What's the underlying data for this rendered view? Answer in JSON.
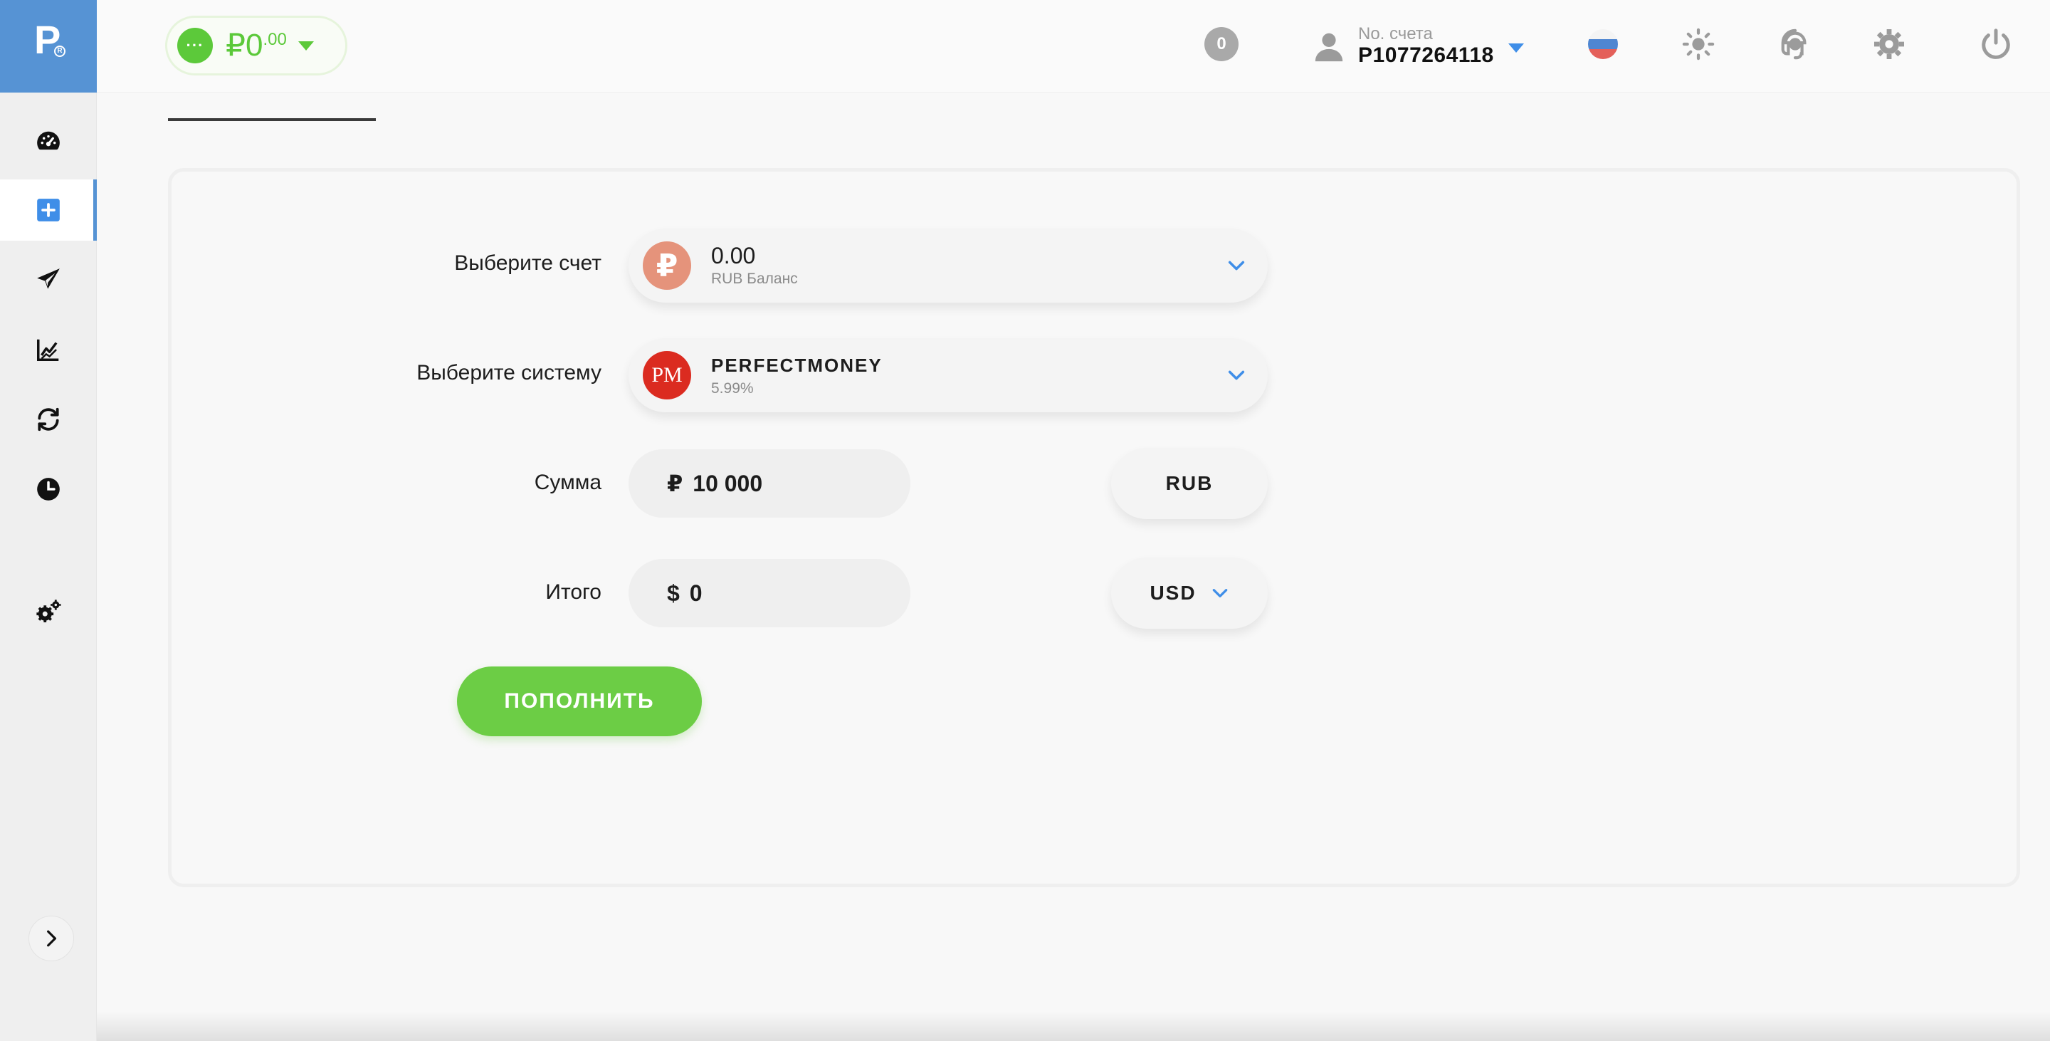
{
  "logo": {
    "letter": "P",
    "mark": "R"
  },
  "sidebar": {
    "items": [
      {
        "name": "dashboard",
        "icon": "speedometer-icon"
      },
      {
        "name": "deposit",
        "icon": "plus-square-icon",
        "active": true
      },
      {
        "name": "send",
        "icon": "paper-plane-icon"
      },
      {
        "name": "statistics",
        "icon": "chart-line-icon"
      },
      {
        "name": "exchange",
        "icon": "refresh-arrows-icon"
      },
      {
        "name": "history",
        "icon": "clock-icon"
      },
      {
        "name": "settings",
        "icon": "gears-icon"
      }
    ],
    "expand_icon": "chevron-right-icon"
  },
  "header": {
    "balance": {
      "currency": "₽",
      "whole": "0",
      "fraction": ".00",
      "dots": "···"
    },
    "notifications_count": "0",
    "account": {
      "label": "No. счета",
      "number": "P1077264118"
    },
    "icons": [
      "russia-flag-icon",
      "sun-icon",
      "support-headset-icon",
      "gear-icon",
      "power-icon"
    ]
  },
  "form": {
    "account": {
      "label": "Выберите счет",
      "value": "0.00",
      "sub": "RUB Баланс",
      "icon_glyph": "₽"
    },
    "system": {
      "label": "Выберите систему",
      "value": "PERFECTMONEY",
      "sub": "5.99%",
      "icon_glyph": "PM"
    },
    "amount": {
      "label": "Сумма",
      "currency_symbol": "₽",
      "value": "10 000",
      "currency": "RUB"
    },
    "total": {
      "label": "Итого",
      "currency_symbol": "$",
      "value": "0",
      "currency": "USD"
    },
    "submit_label": "ПОПОЛНИТЬ"
  },
  "colors": {
    "brand_blue": "#5693d4",
    "green": "#6ccd45",
    "rub_coin": "#e5937b",
    "pm_red": "#db2b20",
    "accent_blue": "#3f8ee8"
  }
}
